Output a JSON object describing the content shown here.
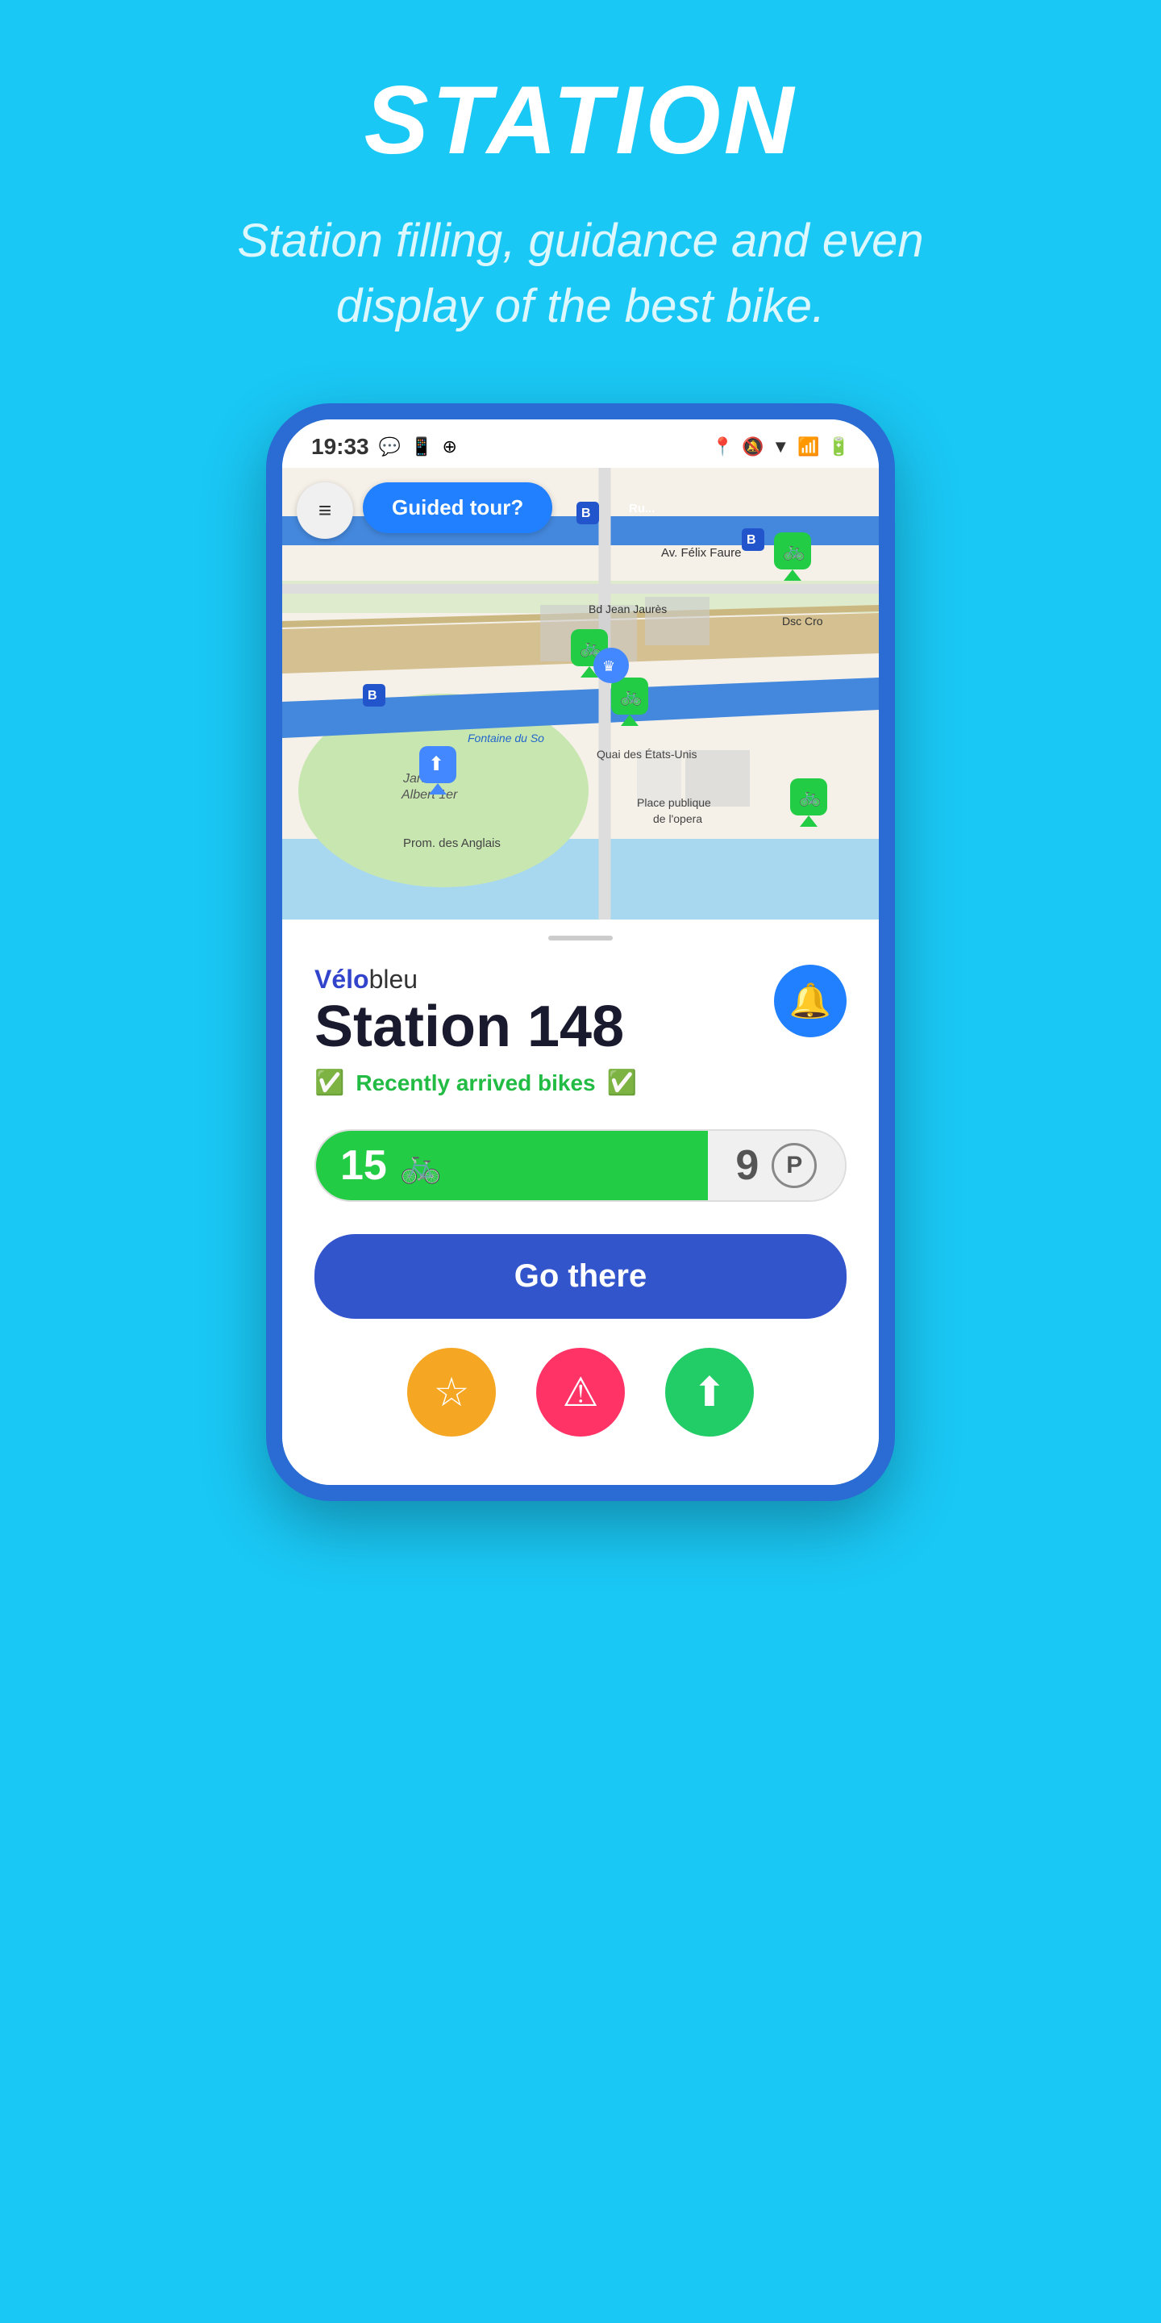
{
  "header": {
    "title": "STATION",
    "subtitle": "Station filling, guidance and even display of the best bike."
  },
  "statusBar": {
    "time": "19:33",
    "leftIcons": [
      "messenger-icon",
      "whatsapp-icon",
      "app-icon"
    ],
    "rightIcons": [
      "location-icon",
      "bell-off-icon",
      "wifi-icon",
      "signal-icon",
      "battery-icon"
    ]
  },
  "map": {
    "guidedTourLabel": "Guided tour?",
    "menuIcon": "≡",
    "labels": {
      "fontaine": "Fontaine du So",
      "jardin": "Jardin Albert 1er",
      "prom": "Prom. des Anglais",
      "quai": "Quai des États-Unis",
      "place": "Place publique de l'opera",
      "bd": "Bd Jean Jaurès",
      "av": "Av. Félix Faure"
    }
  },
  "station": {
    "brandVelo": "Vélo",
    "brandBleu": "bleu",
    "stationLabel": "Station 148",
    "arrivedLabel": "Recently arrived bikes",
    "bikesCount": "15",
    "parkingCount": "9",
    "parkingLabel": "P",
    "goThereLabel": "Go there",
    "bellIcon": "🔔"
  },
  "actions": {
    "starIcon": "☆",
    "alertIcon": "⚠",
    "shareIcon": "⬆",
    "colors": {
      "star": "#f5a623",
      "alert": "#ff3366",
      "share": "#22cc66"
    }
  },
  "colors": {
    "background": "#1ac8f5",
    "phoneFrame": "#2b6cd4",
    "mapBlueRoad": "#4080ff",
    "stationBlue": "#2080ff",
    "bikeGreen": "#22cc44"
  }
}
